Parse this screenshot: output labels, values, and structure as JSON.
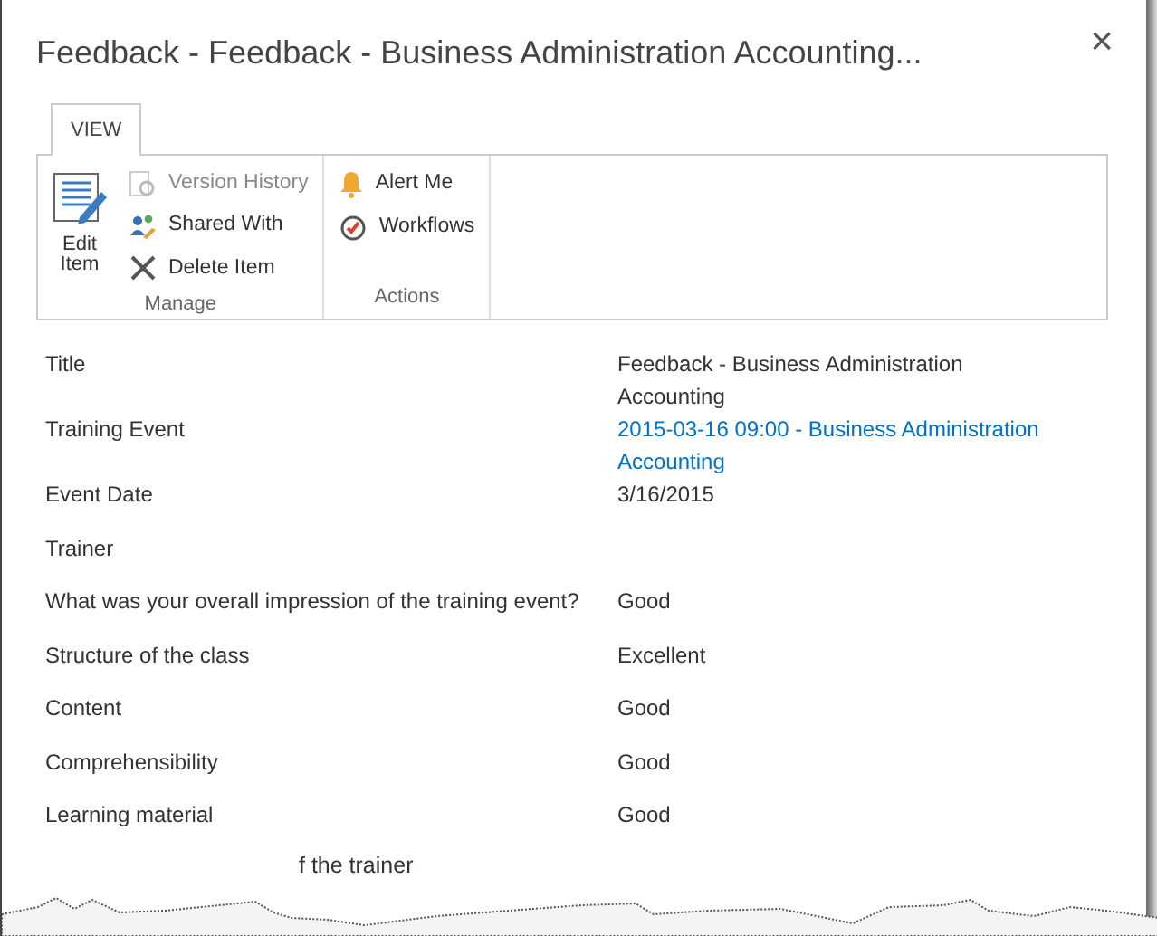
{
  "dialog": {
    "title": "Feedback - Feedback - Business Administration Accounting...",
    "close": "×"
  },
  "tabs": [
    {
      "label": "VIEW",
      "selected": true
    }
  ],
  "ribbon": {
    "groups": [
      {
        "label": "Manage",
        "large": {
          "label": "Edit Item",
          "kind": "edit"
        },
        "items": [
          {
            "label": "Version History",
            "kind": "history",
            "disabled": true
          },
          {
            "label": "Shared With",
            "kind": "people",
            "disabled": false
          },
          {
            "label": "Delete Item",
            "kind": "delete",
            "disabled": false
          }
        ]
      },
      {
        "label": "Actions",
        "items": [
          {
            "label": "Alert Me",
            "kind": "bell",
            "disabled": false
          },
          {
            "label": "Workflows",
            "kind": "workflow",
            "disabled": false
          }
        ]
      }
    ]
  },
  "fields": [
    {
      "label": "Title",
      "value": "Feedback - Business Administration Accounting",
      "kind": "text"
    },
    {
      "label": "Training Event",
      "value": "2015-03-16 09:00 - Business Administration Accounting",
      "kind": "link"
    },
    {
      "label": "Event Date",
      "value": "3/16/2015",
      "kind": "text"
    },
    {
      "label": "Trainer"
    },
    {
      "label": "What was your overall impression of the training event?",
      "value": "Good",
      "kind": "text"
    },
    {
      "label": "Structure of the class",
      "value": "Excellent",
      "kind": "text"
    },
    {
      "label": "Content",
      "value": "Good",
      "kind": "text"
    },
    {
      "label": "Comprehensibility",
      "value": "Good",
      "kind": "text"
    },
    {
      "label": "Learning material",
      "value": "Good",
      "kind": "text"
    }
  ],
  "cut_off_row": {
    "label": "f the trainer"
  }
}
